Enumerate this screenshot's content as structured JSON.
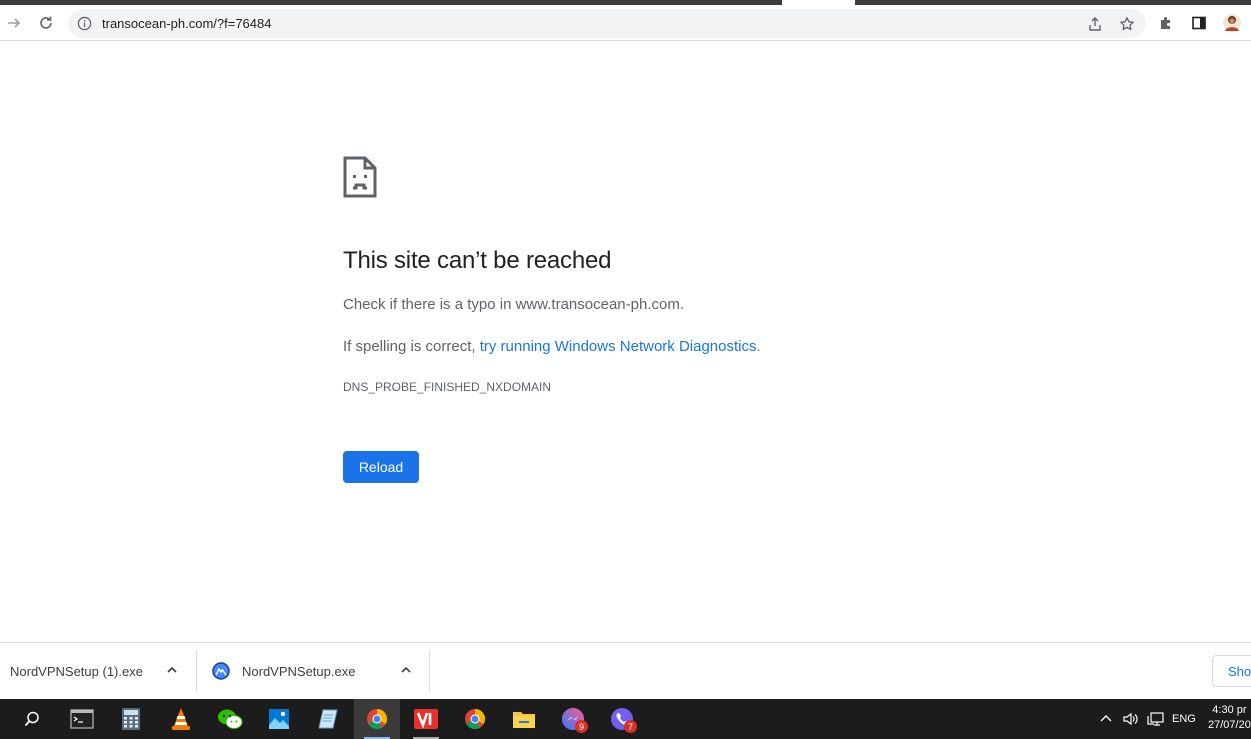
{
  "browser": {
    "url": "transocean-ph.com/?f=76484"
  },
  "error_page": {
    "title": "This site can’t be reached",
    "line1": "Check if there is a typo in www.transocean-ph.com.",
    "line2_prefix": "If spelling is correct, ",
    "line2_link": "try running Windows Network Diagnostics",
    "line2_suffix": ".",
    "error_code": "DNS_PROBE_FINISHED_NXDOMAIN",
    "reload_label": "Reload",
    "accent_color": "#1a73e8"
  },
  "downloads": {
    "items": [
      {
        "name": "NordVPNSetup (1).exe",
        "icon": "generic-file-icon"
      },
      {
        "name": "NordVPNSetup.exe",
        "icon": "nordvpn-icon"
      }
    ],
    "show_all_label": "Show"
  },
  "taskbar": {
    "apps": [
      {
        "icon": "search-icon"
      },
      {
        "icon": "terminal-icon"
      },
      {
        "icon": "calculator-icon"
      },
      {
        "icon": "vlc-icon"
      },
      {
        "icon": "wechat-icon"
      },
      {
        "icon": "photos-icon"
      },
      {
        "icon": "notepad-icon"
      },
      {
        "icon": "chrome-icon",
        "active": true
      },
      {
        "icon": "vi-app-icon"
      },
      {
        "icon": "chrome-icon"
      },
      {
        "icon": "file-explorer-icon"
      },
      {
        "icon": "messenger-icon",
        "badge": "9"
      },
      {
        "icon": "viber-icon",
        "badge": "7"
      }
    ],
    "tray": {
      "language": "ENG",
      "time": "4:30 pr",
      "date": "27/07/20"
    }
  }
}
